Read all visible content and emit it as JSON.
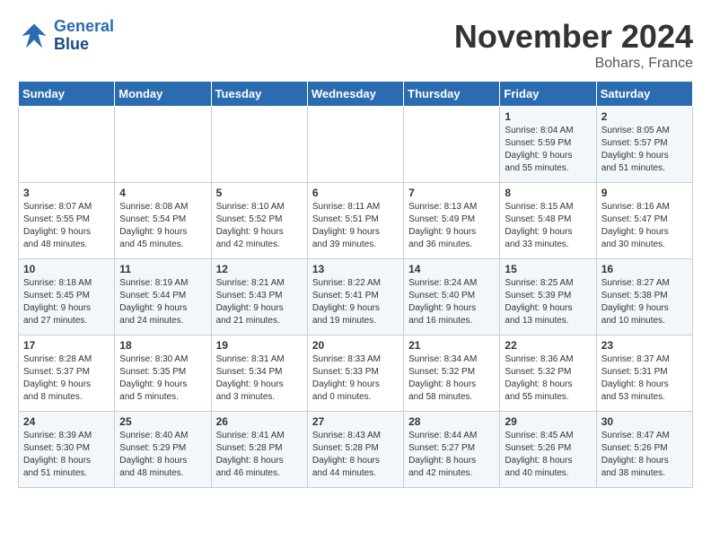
{
  "header": {
    "logo_line1": "General",
    "logo_line2": "Blue",
    "month": "November 2024",
    "location": "Bohars, France"
  },
  "weekdays": [
    "Sunday",
    "Monday",
    "Tuesday",
    "Wednesday",
    "Thursday",
    "Friday",
    "Saturday"
  ],
  "weeks": [
    [
      {
        "day": "",
        "info": ""
      },
      {
        "day": "",
        "info": ""
      },
      {
        "day": "",
        "info": ""
      },
      {
        "day": "",
        "info": ""
      },
      {
        "day": "",
        "info": ""
      },
      {
        "day": "1",
        "info": "Sunrise: 8:04 AM\nSunset: 5:59 PM\nDaylight: 9 hours\nand 55 minutes."
      },
      {
        "day": "2",
        "info": "Sunrise: 8:05 AM\nSunset: 5:57 PM\nDaylight: 9 hours\nand 51 minutes."
      }
    ],
    [
      {
        "day": "3",
        "info": "Sunrise: 8:07 AM\nSunset: 5:55 PM\nDaylight: 9 hours\nand 48 minutes."
      },
      {
        "day": "4",
        "info": "Sunrise: 8:08 AM\nSunset: 5:54 PM\nDaylight: 9 hours\nand 45 minutes."
      },
      {
        "day": "5",
        "info": "Sunrise: 8:10 AM\nSunset: 5:52 PM\nDaylight: 9 hours\nand 42 minutes."
      },
      {
        "day": "6",
        "info": "Sunrise: 8:11 AM\nSunset: 5:51 PM\nDaylight: 9 hours\nand 39 minutes."
      },
      {
        "day": "7",
        "info": "Sunrise: 8:13 AM\nSunset: 5:49 PM\nDaylight: 9 hours\nand 36 minutes."
      },
      {
        "day": "8",
        "info": "Sunrise: 8:15 AM\nSunset: 5:48 PM\nDaylight: 9 hours\nand 33 minutes."
      },
      {
        "day": "9",
        "info": "Sunrise: 8:16 AM\nSunset: 5:47 PM\nDaylight: 9 hours\nand 30 minutes."
      }
    ],
    [
      {
        "day": "10",
        "info": "Sunrise: 8:18 AM\nSunset: 5:45 PM\nDaylight: 9 hours\nand 27 minutes."
      },
      {
        "day": "11",
        "info": "Sunrise: 8:19 AM\nSunset: 5:44 PM\nDaylight: 9 hours\nand 24 minutes."
      },
      {
        "day": "12",
        "info": "Sunrise: 8:21 AM\nSunset: 5:43 PM\nDaylight: 9 hours\nand 21 minutes."
      },
      {
        "day": "13",
        "info": "Sunrise: 8:22 AM\nSunset: 5:41 PM\nDaylight: 9 hours\nand 19 minutes."
      },
      {
        "day": "14",
        "info": "Sunrise: 8:24 AM\nSunset: 5:40 PM\nDaylight: 9 hours\nand 16 minutes."
      },
      {
        "day": "15",
        "info": "Sunrise: 8:25 AM\nSunset: 5:39 PM\nDaylight: 9 hours\nand 13 minutes."
      },
      {
        "day": "16",
        "info": "Sunrise: 8:27 AM\nSunset: 5:38 PM\nDaylight: 9 hours\nand 10 minutes."
      }
    ],
    [
      {
        "day": "17",
        "info": "Sunrise: 8:28 AM\nSunset: 5:37 PM\nDaylight: 9 hours\nand 8 minutes."
      },
      {
        "day": "18",
        "info": "Sunrise: 8:30 AM\nSunset: 5:35 PM\nDaylight: 9 hours\nand 5 minutes."
      },
      {
        "day": "19",
        "info": "Sunrise: 8:31 AM\nSunset: 5:34 PM\nDaylight: 9 hours\nand 3 minutes."
      },
      {
        "day": "20",
        "info": "Sunrise: 8:33 AM\nSunset: 5:33 PM\nDaylight: 9 hours\nand 0 minutes."
      },
      {
        "day": "21",
        "info": "Sunrise: 8:34 AM\nSunset: 5:32 PM\nDaylight: 8 hours\nand 58 minutes."
      },
      {
        "day": "22",
        "info": "Sunrise: 8:36 AM\nSunset: 5:32 PM\nDaylight: 8 hours\nand 55 minutes."
      },
      {
        "day": "23",
        "info": "Sunrise: 8:37 AM\nSunset: 5:31 PM\nDaylight: 8 hours\nand 53 minutes."
      }
    ],
    [
      {
        "day": "24",
        "info": "Sunrise: 8:39 AM\nSunset: 5:30 PM\nDaylight: 8 hours\nand 51 minutes."
      },
      {
        "day": "25",
        "info": "Sunrise: 8:40 AM\nSunset: 5:29 PM\nDaylight: 8 hours\nand 48 minutes."
      },
      {
        "day": "26",
        "info": "Sunrise: 8:41 AM\nSunset: 5:28 PM\nDaylight: 8 hours\nand 46 minutes."
      },
      {
        "day": "27",
        "info": "Sunrise: 8:43 AM\nSunset: 5:28 PM\nDaylight: 8 hours\nand 44 minutes."
      },
      {
        "day": "28",
        "info": "Sunrise: 8:44 AM\nSunset: 5:27 PM\nDaylight: 8 hours\nand 42 minutes."
      },
      {
        "day": "29",
        "info": "Sunrise: 8:45 AM\nSunset: 5:26 PM\nDaylight: 8 hours\nand 40 minutes."
      },
      {
        "day": "30",
        "info": "Sunrise: 8:47 AM\nSunset: 5:26 PM\nDaylight: 8 hours\nand 38 minutes."
      }
    ]
  ]
}
